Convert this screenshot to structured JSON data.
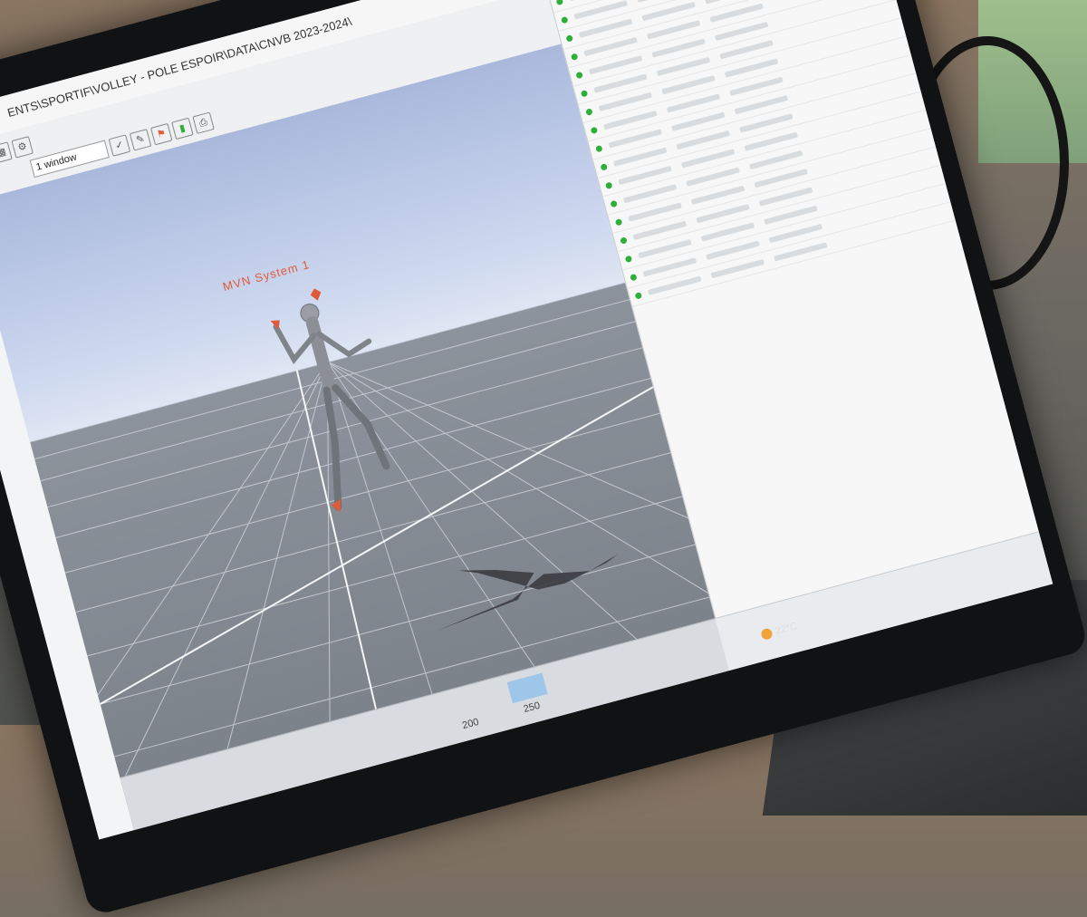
{
  "window": {
    "title": "ENTS\\SPORTIF\\VOLLEY - POLE ESPOIR\\DATA\\CNVB 2023-2024\\"
  },
  "toolbar": {
    "window_select": "1 window"
  },
  "viewport": {
    "system_label": "MVN System 1"
  },
  "timeline": {
    "tick_200": "200",
    "tick_250": "250"
  },
  "taskbar": {
    "weather": "22°C"
  },
  "colors": {
    "accent": "#e05a3a",
    "status_ok": "#2fae3a",
    "timeline_cursor": "#8fc0ea"
  }
}
